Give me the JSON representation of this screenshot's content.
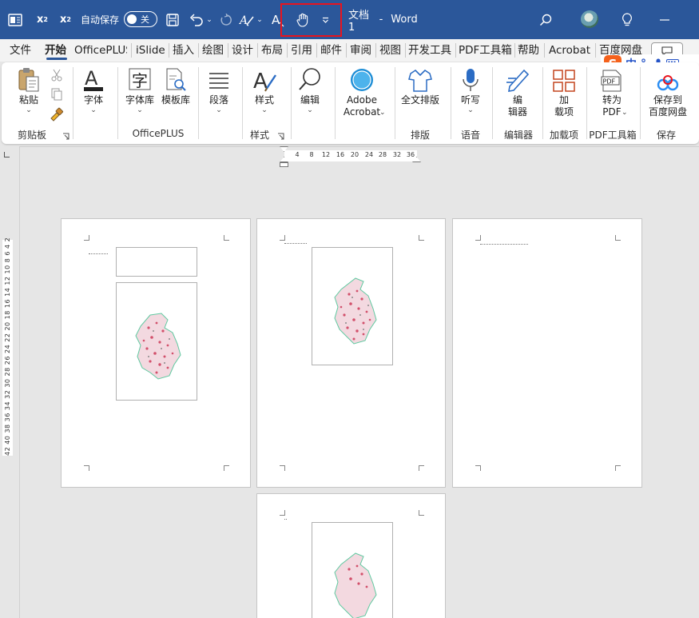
{
  "titlebar": {
    "autosave_label": "自动保存",
    "autosave_state": "关",
    "doc_name": "文档1",
    "separator": "-",
    "app_name": "Word"
  },
  "tabs": [
    "文件",
    "开始",
    "OfficePLUS",
    "iSlide",
    "插入",
    "绘图",
    "设计",
    "布局",
    "引用",
    "邮件",
    "审阅",
    "视图",
    "开发工具",
    "PDF工具箱",
    "帮助",
    "Acrobat",
    "百度网盘"
  ],
  "ime": {
    "logo": "S",
    "mode": "中",
    "punct": "°,"
  },
  "ribbon": {
    "paste": "粘贴",
    "clipboard_group": "剪贴板",
    "font": "字体",
    "font_library": "字体库",
    "template_library": "模板库",
    "officeplus_group": "OfficePLUS",
    "paragraph": "段落",
    "styles": "样式",
    "styles_group": "样式",
    "editing": "编辑",
    "adobe_line1": "Adobe",
    "adobe_line2": "Acrobat",
    "full_layout": "全文排版",
    "layout_group": "排版",
    "dictate": "听写",
    "voice_group": "语音",
    "editor_line1": "编",
    "editor_line2": "辑器",
    "editor_group": "编辑器",
    "addins_line1": "加",
    "addins_line2": "载项",
    "addins_group": "加载项",
    "to_pdf_line1": "转为",
    "to_pdf_line2": "PDF",
    "pdf_group": "PDF工具箱",
    "save_baidu_line1": "保存到",
    "save_baidu_line2": "百度网盘",
    "save_group": "保存"
  },
  "hruler_ticks": [
    "4",
    "8",
    "12",
    "16",
    "20",
    "24",
    "28",
    "32",
    "36"
  ],
  "vruler_text": "42 40 38 36 34 32 30 28 26 24 22 20 18 16 14 12 10 8 6 4 2"
}
